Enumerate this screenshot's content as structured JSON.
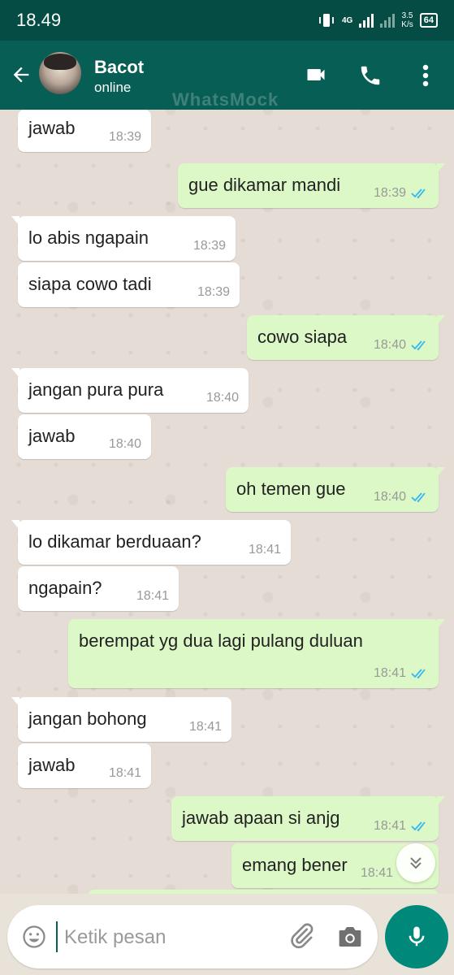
{
  "status_bar": {
    "time": "18.49",
    "network": "4G",
    "speed_value": "3.5",
    "speed_unit": "K/s",
    "battery": "64"
  },
  "header": {
    "contact_name": "Bacot",
    "contact_status": "online",
    "watermark": "WhatsMock"
  },
  "messages": [
    {
      "dir": "in",
      "text": "jawab",
      "time": "18:39"
    },
    {
      "dir": "out",
      "text": "gue dikamar mandi",
      "time": "18:39",
      "ticks": "double-check-read"
    },
    {
      "dir": "in",
      "text": "lo abis ngapain",
      "time": "18:39"
    },
    {
      "dir": "in",
      "text": "siapa cowo tadi",
      "time": "18:39"
    },
    {
      "dir": "out",
      "text": "cowo siapa",
      "time": "18:40",
      "ticks": "double-check-read"
    },
    {
      "dir": "in",
      "text": "jangan pura pura",
      "time": "18:40"
    },
    {
      "dir": "in",
      "text": "jawab",
      "time": "18:40"
    },
    {
      "dir": "out",
      "text": "oh temen gue",
      "time": "18:40",
      "ticks": "double-check-read"
    },
    {
      "dir": "in",
      "text": "lo dikamar berduaan?",
      "time": "18:41"
    },
    {
      "dir": "in",
      "text": "ngapain?",
      "time": "18:41"
    },
    {
      "dir": "out",
      "text": "berempat yg dua lagi pulang duluan",
      "time": "18:41",
      "ticks": "double-check-read"
    },
    {
      "dir": "in",
      "text": "jangan bohong",
      "time": "18:41"
    },
    {
      "dir": "in",
      "text": "jawab",
      "time": "18:41"
    },
    {
      "dir": "out",
      "text": "jawab apaan si anjg",
      "time": "18:41",
      "ticks": "double-check-read"
    },
    {
      "dir": "out",
      "text": "emang bener",
      "time": "18:41"
    }
  ],
  "input": {
    "placeholder": "Ketik pesan"
  },
  "colors": {
    "header": "#075e54",
    "status_bar": "#054d44",
    "outgoing": "#dcf8c6",
    "incoming": "#ffffff",
    "read_ticks": "#34b7f1",
    "mic_button": "#00897b"
  },
  "icons": [
    "back-arrow-icon",
    "video-call-icon",
    "phone-icon",
    "more-vert-icon",
    "emoji-icon",
    "attach-icon",
    "camera-icon",
    "mic-icon",
    "chevron-double-down-icon"
  ]
}
